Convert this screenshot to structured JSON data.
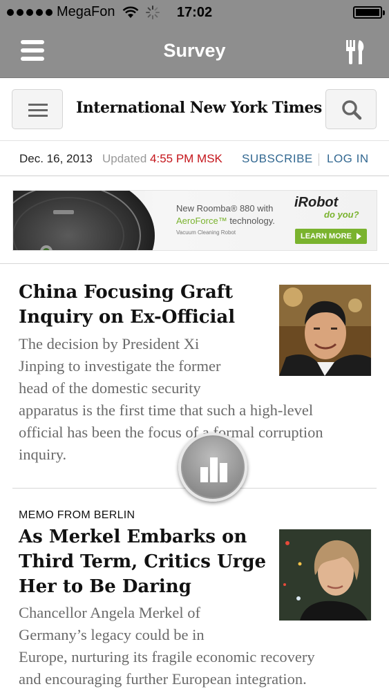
{
  "status_bar": {
    "carrier": "MegaFon",
    "time": "17:02"
  },
  "app_bar": {
    "title": "Survey",
    "menu_icon": "hamburger-icon",
    "tools_icon": "tools-icon"
  },
  "site_header": {
    "masthead": "International New York Times",
    "menu_icon": "menu-icon",
    "search_icon": "search-icon"
  },
  "date_row": {
    "date": "Dec. 16, 2013",
    "updated_label": "Updated",
    "updated_time": "4:55 PM MSK",
    "subscribe": "SUBSCRIBE",
    "login": "LOG IN"
  },
  "ad": {
    "line1": "New Roomba® 880 with",
    "line2_brand": "AeroForce™",
    "line2_rest": " technology.",
    "line3": "Vacuum Cleaning Robot",
    "brand": "iRobot",
    "slogan": "do you?",
    "cta": "LEARN MORE"
  },
  "articles": [
    {
      "headline_lines": [
        "China Focusing Graft",
        "Inquiry on Ex-Official"
      ],
      "summary_lines": [
        "The decision by President Xi",
        "Jinping to investigate the former",
        "head of the domestic security",
        "apparatus is the first time that such a high-level",
        "official has been the focus of a formal corruption",
        "inquiry."
      ]
    },
    {
      "kicker": "MEMO FROM BERLIN",
      "headline_lines": [
        "As Merkel Embarks on",
        "Third Term, Critics Urge",
        "Her to Be Daring"
      ],
      "summary_lines": [
        "Chancellor Angela Merkel of",
        "Germany’s legacy could be in",
        "Europe, nurturing its fragile economic recovery",
        "and encouraging further European integration."
      ]
    }
  ],
  "floating_button": {
    "icon": "bar-chart-icon"
  },
  "colors": {
    "nav_gray": "#8e8e8e",
    "link_blue": "#326891",
    "updated_red": "#c4141a",
    "ad_green": "#7ab32e"
  }
}
